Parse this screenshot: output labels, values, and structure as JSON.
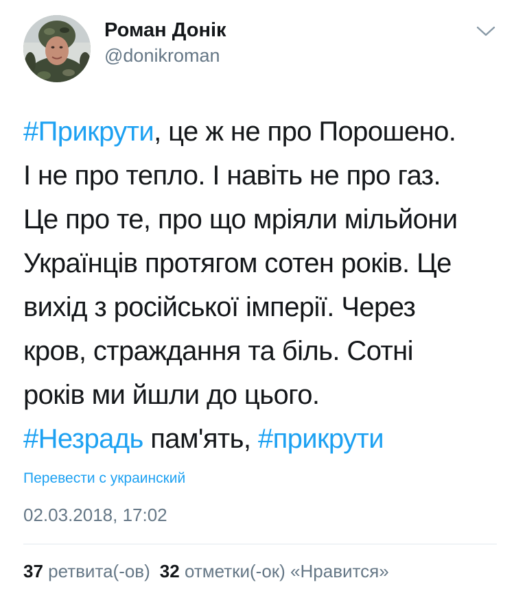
{
  "author": {
    "name": "Роман Донік",
    "handle": "@donikroman"
  },
  "tweet": {
    "lines": [
      {
        "hashtag": "#Прикрути",
        "text": ", це ж не про Порошено."
      },
      {
        "text": "І не про тепло. І навіть не про газ."
      },
      {
        "text": "Це про те, про що мріяли мільйони"
      },
      {
        "text": "Українців протягом сотен років. Це"
      },
      {
        "text": "вихід з російської імперії. Через"
      },
      {
        "text": "кров, страждання та біль. Сотні"
      },
      {
        "text": "років ми йшли до цього."
      },
      {
        "hashtag": "#Незрадь",
        "text": " пам'ять, ",
        "hashtag2": "#прикрути"
      }
    ]
  },
  "translate_label": "Перевести с украинский",
  "timestamp": "02.03.2018, 17:02",
  "stats": {
    "retweets_count": "37",
    "retweets_label": "ретвита(-ов)",
    "likes_count": "32",
    "likes_label": "отметки(-ок) «Нравится»"
  },
  "icons": {
    "menu": "chevron-down-icon"
  },
  "colors": {
    "link": "#1da1f2",
    "secondary_text": "#657786",
    "primary_text": "#14171a",
    "divider": "#e1e8ed"
  }
}
